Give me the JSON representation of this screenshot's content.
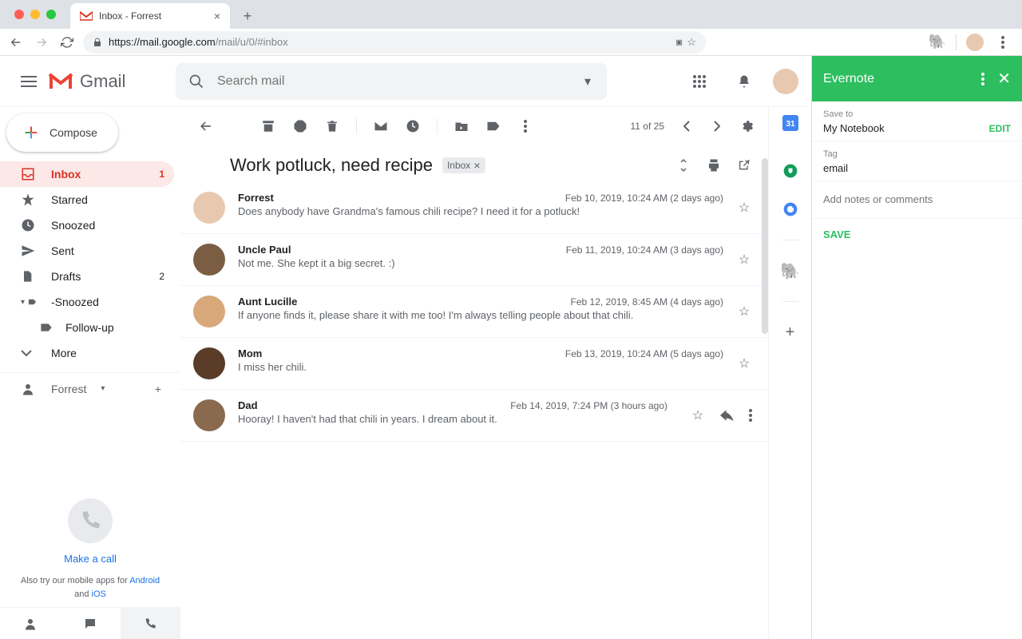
{
  "browser": {
    "tab_title": "Inbox - Forrest",
    "url_host": "https://mail.google.com",
    "url_path": "/mail/u/0/#inbox"
  },
  "header": {
    "product": "Gmail",
    "search_placeholder": "Search mail"
  },
  "compose": {
    "label": "Compose"
  },
  "sidebar": {
    "items": [
      {
        "icon": "inbox",
        "label": "Inbox",
        "count": "1",
        "active": true
      },
      {
        "icon": "star",
        "label": "Starred"
      },
      {
        "icon": "clock",
        "label": "Snoozed"
      },
      {
        "icon": "send",
        "label": "Sent"
      },
      {
        "icon": "file",
        "label": "Drafts",
        "count": "2"
      },
      {
        "icon": "caret-label",
        "label": "-Snoozed"
      },
      {
        "icon": "label",
        "label": "Follow-up",
        "nested": true
      },
      {
        "icon": "chevron",
        "label": "More"
      }
    ],
    "hangouts_user": "Forrest",
    "make_call": "Make a call",
    "mobile_apps_1": "Also try our mobile apps for ",
    "mobile_apps_android": "Android",
    "mobile_apps_and": " and ",
    "mobile_apps_ios": "iOS"
  },
  "toolbar": {
    "counter": "11 of 25"
  },
  "thread": {
    "subject": "Work potluck, need recipe",
    "chip": "Inbox"
  },
  "messages": [
    {
      "from": "Forrest",
      "date": "Feb 10, 2019, 10:24 AM (2 days ago)",
      "snippet": "Does anybody have Grandma's famous chili recipe? I need it for a potluck!",
      "avatar": "#e8c9b0"
    },
    {
      "from": "Uncle Paul",
      "date": "Feb 11, 2019, 10:24 AM (3 days ago)",
      "snippet": "Not me. She kept it a big secret. :)",
      "avatar": "#7b5d44"
    },
    {
      "from": "Aunt Lucille",
      "date": "Feb 12, 2019, 8:45 AM (4 days ago)",
      "snippet": "If anyone finds it, please share it with me too! I'm always telling people about that chili.",
      "avatar": "#d9a87a"
    },
    {
      "from": "Mom",
      "date": "Feb 13, 2019, 10:24 AM (5 days ago)",
      "snippet": "I miss her chili.",
      "avatar": "#5a3c28"
    },
    {
      "from": "Dad",
      "date": "Feb 14, 2019, 7:24 PM (3 hours ago)",
      "snippet": "Hooray! I haven't had that chili in years. I dream about it.",
      "avatar": "#8a6a4f",
      "last": true
    }
  ],
  "evernote": {
    "title": "Evernote",
    "save_to_label": "Save to",
    "save_to_value": "My Notebook",
    "edit": "EDIT",
    "tag_label": "Tag",
    "tag_value": "email",
    "notes_placeholder": "Add notes or comments",
    "save": "SAVE"
  }
}
